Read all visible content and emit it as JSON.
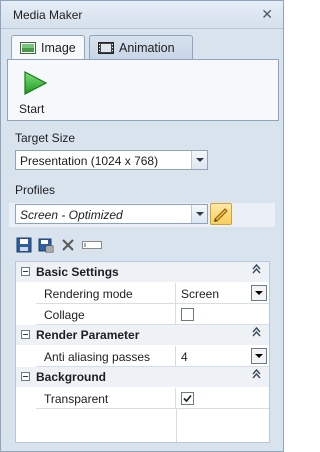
{
  "window": {
    "title": "Media Maker",
    "close_glyph": "✕"
  },
  "tabs": [
    {
      "label": "Image",
      "icon": "image-icon",
      "active": true
    },
    {
      "label": "Animation",
      "icon": "film-icon",
      "active": false
    }
  ],
  "ribbon": {
    "start_label": "Start",
    "start_icon": "play-icon",
    "accent": "#2fae2f"
  },
  "target_size": {
    "label": "Target Size",
    "value": "Presentation (1024 x 768)"
  },
  "profiles": {
    "label": "Profiles",
    "value": "Screen - Optimized",
    "edit_icon": "pencil-icon",
    "toolbar": [
      "save-icon",
      "save-as-icon",
      "delete-icon",
      "rename-icon"
    ]
  },
  "property_grid": {
    "categories": [
      {
        "label": "Basic Settings",
        "rows": [
          {
            "name": "Rendering mode",
            "value": "Screen",
            "type": "dropdown"
          },
          {
            "name": "Collage",
            "checked": false,
            "type": "checkbox"
          }
        ]
      },
      {
        "label": "Render Parameter",
        "rows": [
          {
            "name": "Anti aliasing passes",
            "value": "4",
            "type": "dropdown"
          }
        ]
      },
      {
        "label": "Background",
        "rows": [
          {
            "name": "Transparent",
            "checked": true,
            "type": "checkbox"
          }
        ]
      }
    ],
    "collapse_glyph": "≈"
  }
}
